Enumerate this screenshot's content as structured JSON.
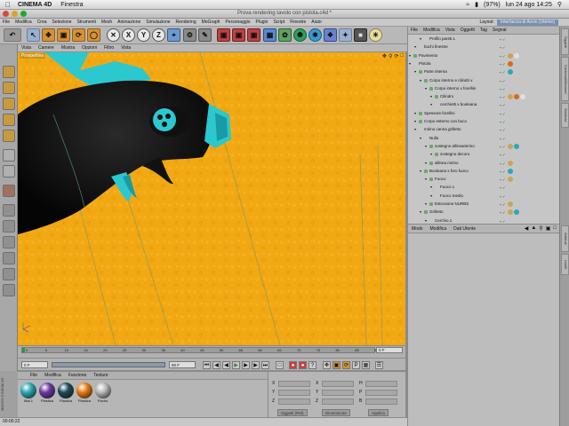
{
  "macbar": {
    "app_name": "CINEMA 4D",
    "menu": "Finestra",
    "battery": "(97%)",
    "clock": "lun 24 ago  14:25"
  },
  "window": {
    "title": "Prova rendering tavolo con pistola.c4d *"
  },
  "mainmenu": {
    "items": [
      "File",
      "Modifica",
      "Crea",
      "Selezione",
      "Strumenti",
      "Mesh",
      "Animazione",
      "Simulazione",
      "Rendering",
      "MoGraph",
      "Personaggio",
      "Plugin",
      "Script",
      "Finestre",
      "Aiuto"
    ],
    "layout_label": "Layout:",
    "layout_value": "Interfaccia di Avvio (Utente)"
  },
  "toolbar": {
    "axis_labels": [
      "X",
      "Y",
      "Z"
    ]
  },
  "viewport": {
    "menu": [
      "Vista",
      "Camere",
      "Mostra",
      "Opzioni",
      "Filtro",
      "Vista"
    ],
    "label": "Prospettiva"
  },
  "objmgr": {
    "menu": [
      "File",
      "Modifica",
      "Vista",
      "Oggetti",
      "Tag",
      "Segnal"
    ],
    "rows": [
      {
        "name": "Profilo pareti.1",
        "level": 2,
        "color": "#c8c8c8",
        "tags": []
      },
      {
        "name": "buchi finestre",
        "level": 1,
        "color": "#c8c8c8",
        "tags": []
      },
      {
        "name": "Pavimento",
        "level": 0,
        "color": "#6aa86a",
        "tags": [
          "#c9a55a",
          "#e0e0e0"
        ]
      },
      {
        "name": "Pistola",
        "level": 0,
        "color": "#c8c8c8",
        "tags": [
          "#d96a1a"
        ]
      },
      {
        "name": "Parte interna",
        "level": 1,
        "color": "#6aa86a",
        "tags": [
          "#2aa8b8"
        ]
      },
      {
        "name": "Corpo interno e cilindri x",
        "level": 2,
        "color": "#6aa86a",
        "tags": []
      },
      {
        "name": "Corpo interno x forellini",
        "level": 3,
        "color": "#6aa86a",
        "tags": []
      },
      {
        "name": "Cilindro",
        "level": 4,
        "color": "#6aa86a",
        "tags": [
          "#c9a55a",
          "#d96a1a",
          "#e0e0e0"
        ]
      },
      {
        "name": "cerchietti x booleana",
        "level": 4,
        "color": "#c8c8c8",
        "tags": []
      },
      {
        "name": "Spessore forellini",
        "level": 1,
        "color": "#6aa86a",
        "tags": []
      },
      {
        "name": "Corpo esterno con buco",
        "level": 1,
        "color": "#6aa86a",
        "tags": []
      },
      {
        "name": "mirino canna grilletto",
        "level": 1,
        "color": "#c8c8c8",
        "tags": []
      },
      {
        "name": "Nullo",
        "level": 2,
        "color": "#c8c8c8",
        "tags": []
      },
      {
        "name": "sostegno allineamirino",
        "level": 3,
        "color": "#6aa86a",
        "tags": [
          "#c9a55a",
          "#2aa8b8"
        ]
      },
      {
        "name": "sostegno decoro",
        "level": 4,
        "color": "#6aa86a",
        "tags": []
      },
      {
        "name": "allinea mirino",
        "level": 3,
        "color": "#6aa86a",
        "tags": [
          "#c9a55a"
        ]
      },
      {
        "name": "Booleana x foro fuoco",
        "level": 2,
        "color": "#6aa86a",
        "tags": [
          "#2aa8b8"
        ]
      },
      {
        "name": "Fuoco",
        "level": 3,
        "color": "#6aa86a",
        "tags": [
          "#c9a55a"
        ]
      },
      {
        "name": "Fuoco x",
        "level": 4,
        "color": "#c8c8c8",
        "tags": []
      },
      {
        "name": "Fuoco medio",
        "level": 4,
        "color": "#c8c8c8",
        "tags": []
      },
      {
        "name": "Estrusione NURBS",
        "level": 3,
        "color": "#6aa86a",
        "tags": [
          "#c9a55a"
        ]
      },
      {
        "name": "Grilletto",
        "level": 2,
        "color": "#6aa86a",
        "tags": [
          "#c9a55a",
          "#2aa8b8"
        ]
      },
      {
        "name": "Cerchio.1",
        "level": 3,
        "color": "#c8c8c8",
        "tags": []
      }
    ]
  },
  "attrmgr": {
    "menu": [
      "Modo",
      "Modifica",
      "Dati Utente"
    ]
  },
  "rightstrip": {
    "tabs": [
      "Oggetti",
      "Contenuti/Browser",
      "Struttura",
      "Attributi",
      "Livelli"
    ]
  },
  "timeline": {
    "ticks": [
      "0",
      "5",
      "10",
      "15",
      "20",
      "25",
      "30",
      "35",
      "40",
      "45",
      "50",
      "55",
      "60",
      "65",
      "70",
      "75",
      "80",
      "85",
      "90"
    ],
    "current_frame": "0 F",
    "start_field": "0 F",
    "end_field": "90 F"
  },
  "matmgr": {
    "menu": [
      "File",
      "Modifica",
      "Funzione",
      "Texture"
    ],
    "materials": [
      {
        "label": "Mat.1",
        "color": "#2aa8b0"
      },
      {
        "label": "Plastica",
        "color": "#6a3aa0"
      },
      {
        "label": "Plastica",
        "color": "#1e4a56"
      },
      {
        "label": "Plastica",
        "color": "#e87a10"
      },
      {
        "label": "Pavim.",
        "color": "#b8b8b8"
      }
    ],
    "brand": "MAXON CINEMA 4D"
  },
  "coordmgr": {
    "rows": [
      [
        "X",
        "X",
        "H"
      ],
      [
        "Y",
        "Y",
        "P"
      ],
      [
        "Z",
        "Z",
        "B"
      ]
    ],
    "mode_button": "Oggetti (Rel)",
    "size_button": "Dimensione",
    "apply_button": "Applica"
  },
  "statusbar": {
    "time": "00:00:22"
  },
  "colors": {
    "floor": "#f1a813",
    "gun_body": "#0a0a0a",
    "gun_accent": "#2cc8d0"
  }
}
